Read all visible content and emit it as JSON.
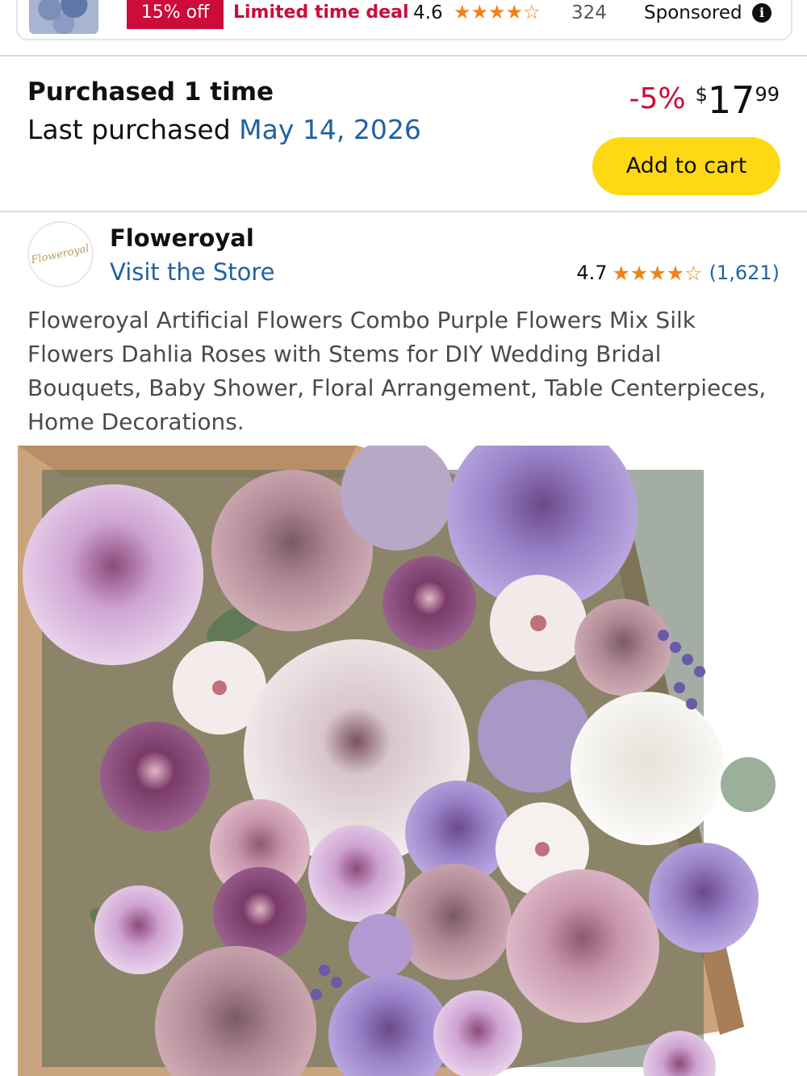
{
  "sponsored_card": {
    "deal_badge": "15% off",
    "deal_text": "Limited time deal",
    "rating": "4.6",
    "stars": "★★★★☆",
    "review_count": "324",
    "sponsored_label": "Sponsored",
    "info_icon": "info-icon"
  },
  "purchase_info": {
    "purchased_title": "Purchased 1 time",
    "last_purchased_label": "Last purchased",
    "last_purchased_date": "May 14, 2026"
  },
  "price": {
    "discount": "-5%",
    "currency": "$",
    "whole": "17",
    "fraction": "99"
  },
  "add_to_cart_label": "Add to cart",
  "store": {
    "logo_text": "Floweroyal",
    "brand_name": "Floweroyal",
    "visit_store_label": "Visit the Store",
    "rating": "4.7",
    "stars": "★★★★☆",
    "rating_count": "(1,621)"
  },
  "product_title": "Floweroyal Artificial Flowers Combo Purple Flowers Mix Silk Flowers Dahlia Roses with Stems for DIY Wedding Bridal Bouquets, Baby Shower, Floral Arrangement, Table Centerpieces, Home Decorations.",
  "colors": {
    "deal_red": "#cc0c39",
    "link_blue": "#2162a1",
    "star_orange": "#f0821c",
    "button_yellow": "#ffd814"
  }
}
